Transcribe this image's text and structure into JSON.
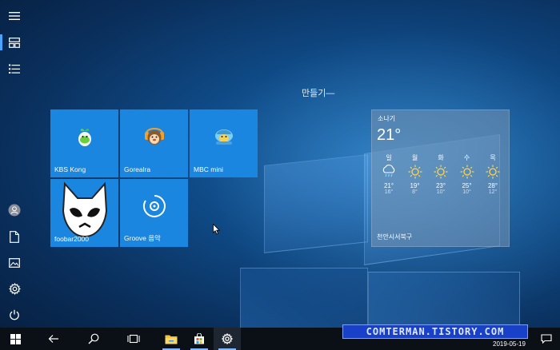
{
  "rail": {
    "items": [
      "hamburger-icon",
      "all-tiles-icon",
      "list-icon",
      "user-icon",
      "document-icon",
      "pictures-icon",
      "gear-icon",
      "power-icon"
    ]
  },
  "start": {
    "group_title": "만들기—",
    "tiles": [
      {
        "label": "KBS Kong",
        "icon": "kbs-kong-icon"
      },
      {
        "label": "Gorealra",
        "icon": "gorealra-icon"
      },
      {
        "label": "MBC mini",
        "icon": "mbc-mini-icon"
      },
      {
        "label": "foobar2000",
        "icon": "foobar2000-icon"
      },
      {
        "label": "Groove 음악",
        "icon": "groove-music-icon"
      }
    ]
  },
  "weather": {
    "condition": "소나기",
    "current_temp": "21°",
    "location": "천안시서북구",
    "days": [
      {
        "day": "일",
        "high": "21°",
        "low": "16°",
        "icon": "rain-icon"
      },
      {
        "day": "월",
        "high": "19°",
        "low": "8°",
        "icon": "sun-icon"
      },
      {
        "day": "화",
        "high": "23°",
        "low": "10°",
        "icon": "sun-icon"
      },
      {
        "day": "수",
        "high": "25°",
        "low": "10°",
        "icon": "sun-icon"
      },
      {
        "day": "목",
        "high": "28°",
        "low": "12°",
        "icon": "sun-icon"
      }
    ]
  },
  "taskbar": {
    "items": [
      "windows-start-icon",
      "back-icon",
      "search-icon",
      "task-view-icon",
      "file-explorer-icon",
      "store-icon",
      "settings-icon"
    ],
    "watermark": "COMTERMAN.TISTORY.COM",
    "date": "2019-05-19"
  },
  "colors": {
    "tile": "#1a86e0",
    "accent": "#4aa3ff",
    "taskbar": "#0b0f16"
  }
}
